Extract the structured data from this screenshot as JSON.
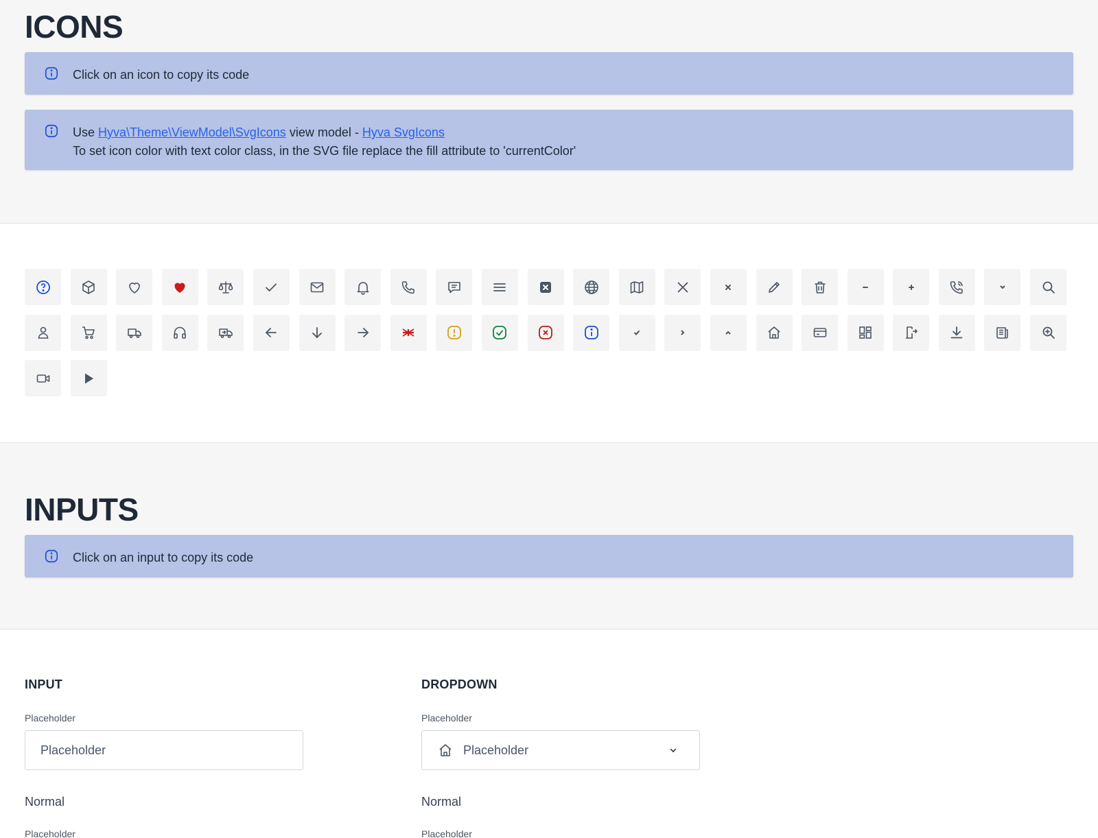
{
  "icons_section": {
    "title": "ICONS",
    "alert_copy": "Click on an icon to copy its code",
    "alert_usage": {
      "prefix": "Use ",
      "link1": "Hyva\\Theme\\ViewModel\\SvgIcons",
      "middle": " view model - ",
      "link2": "Hyva SvgIcons",
      "line2": "To set icon color with text color class, in the SVG file replace the fill attribute to 'currentColor'"
    },
    "icons": [
      "question-circle-icon",
      "cube-icon",
      "heart-outline-icon",
      "heart-filled-icon",
      "scale-icon",
      "check-icon",
      "mail-icon",
      "bell-icon",
      "phone-icon",
      "chat-icon",
      "menu-icon",
      "x-square-icon",
      "globe-icon",
      "map-icon",
      "x-large-icon",
      "x-small-icon",
      "pencil-icon",
      "trash-icon",
      "minus-icon",
      "plus-icon",
      "phone-ring-icon",
      "chevron-down-small-icon",
      "search-icon",
      "user-icon",
      "cart-icon",
      "truck-icon",
      "headphones-icon",
      "delivery-van-icon",
      "arrow-left-icon",
      "arrow-down-icon",
      "arrow-right-icon",
      "uk-flag-icon",
      "warning-square-icon",
      "success-square-icon",
      "error-square-icon",
      "info-square-icon",
      "check-small-icon",
      "chevron-right-icon",
      "chevron-up-icon",
      "home-icon",
      "credit-card-icon",
      "dashboard-icon",
      "share-door-icon",
      "download-icon",
      "newspaper-icon",
      "zoom-in-icon",
      "video-icon",
      "play-icon"
    ]
  },
  "inputs_section": {
    "title": "INPUTS",
    "alert_copy": "Click on an input to copy its code",
    "input": {
      "heading": "INPUT",
      "label": "Placeholder",
      "placeholder": "Placeholder",
      "state": "Normal",
      "next_label": "Placeholder"
    },
    "dropdown": {
      "heading": "DROPDOWN",
      "label": "Placeholder",
      "value": "Placeholder",
      "state": "Normal",
      "next_label": "Placeholder"
    }
  },
  "colors": {
    "alert_bg": "#b6c2e6",
    "link": "#2563eb",
    "icon_default": "#4b5563",
    "heart_red": "#c81e1e",
    "info_blue": "#1d4ed8",
    "warning_amber": "#d4a017",
    "success_green": "#15803d",
    "error_red": "#b91c1c"
  }
}
